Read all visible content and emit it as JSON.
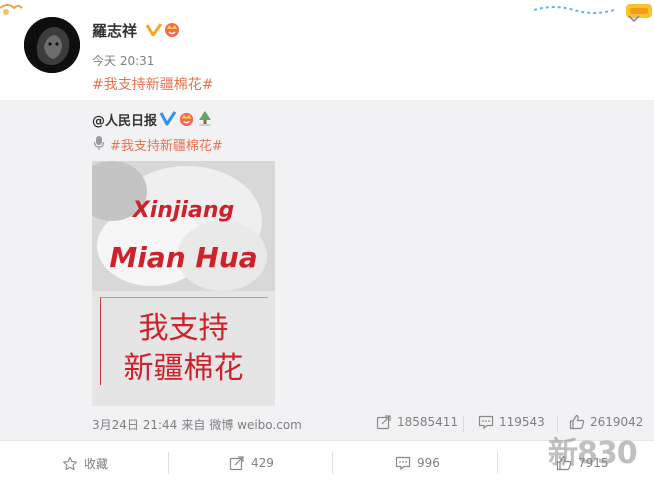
{
  "post": {
    "author": "羅志祥",
    "time": "今天 20:31",
    "hashtag": "#我支持新疆棉花#"
  },
  "repost": {
    "author": "@人民日报",
    "hashtag": "#我支持新疆棉花#",
    "image": {
      "line1": "Xinjiang",
      "line2": "Mian Hua",
      "line3": "我支持",
      "line4": "新疆棉花"
    },
    "timestamp": "3月24日 21:44",
    "source_prefix": "来自",
    "source": "微博 weibo.com",
    "stats": {
      "reposts": "18585411",
      "comments": "119543",
      "likes": "2619042"
    }
  },
  "actions": {
    "favorite": "收藏",
    "forward": "429",
    "comment": "996",
    "like": "7915"
  },
  "watermark": "新830",
  "colors": {
    "link": "#eb7350",
    "verified": "#f7a71c",
    "poster_text": "#d0212a"
  }
}
